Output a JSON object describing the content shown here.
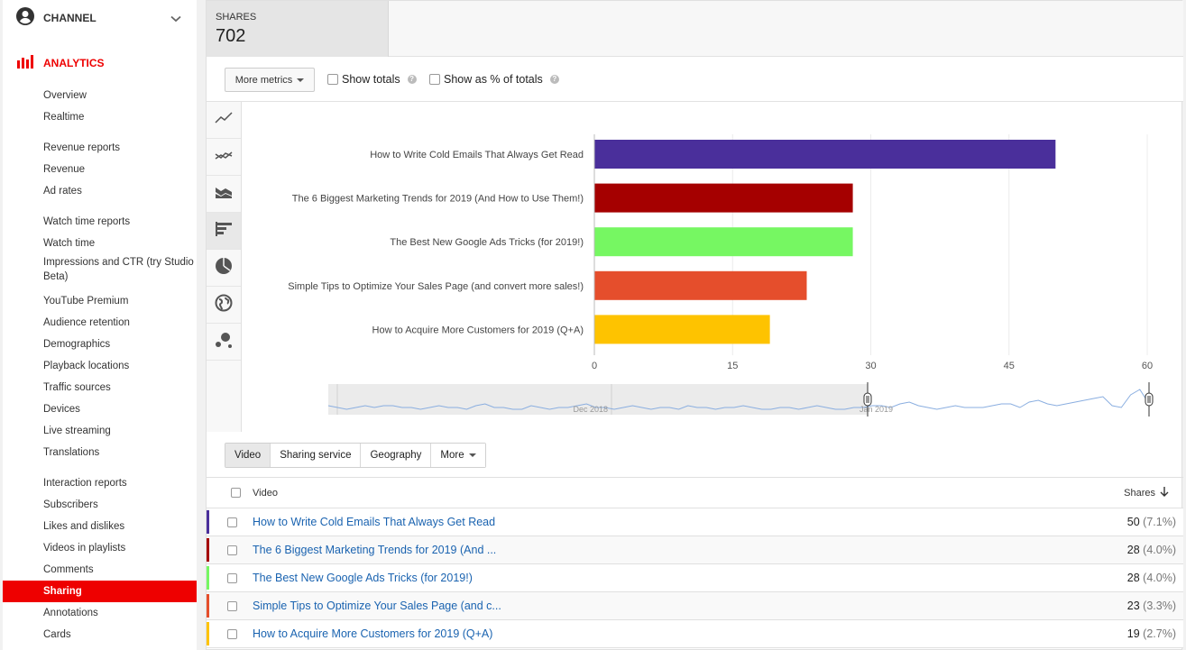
{
  "sidebar": {
    "channel_label": "CHANNEL",
    "analytics_label": "ANALYTICS",
    "items": [
      {
        "label": "Overview",
        "type": "item"
      },
      {
        "label": "Realtime",
        "type": "item"
      },
      {
        "label": "Revenue reports",
        "type": "section"
      },
      {
        "label": "Revenue",
        "type": "item"
      },
      {
        "label": "Ad rates",
        "type": "item"
      },
      {
        "label": "Watch time reports",
        "type": "section"
      },
      {
        "label": "Watch time",
        "type": "item"
      },
      {
        "label": "Impressions and CTR (try Studio Beta)",
        "type": "item"
      },
      {
        "label": "YouTube Premium",
        "type": "item"
      },
      {
        "label": "Audience retention",
        "type": "item"
      },
      {
        "label": "Demographics",
        "type": "item"
      },
      {
        "label": "Playback locations",
        "type": "item"
      },
      {
        "label": "Traffic sources",
        "type": "item"
      },
      {
        "label": "Devices",
        "type": "item"
      },
      {
        "label": "Live streaming",
        "type": "item"
      },
      {
        "label": "Translations",
        "type": "item"
      },
      {
        "label": "Interaction reports",
        "type": "section"
      },
      {
        "label": "Subscribers",
        "type": "item"
      },
      {
        "label": "Likes and dislikes",
        "type": "item"
      },
      {
        "label": "Videos in playlists",
        "type": "item"
      },
      {
        "label": "Comments",
        "type": "item"
      },
      {
        "label": "Sharing",
        "type": "item",
        "active": true
      },
      {
        "label": "Annotations",
        "type": "item"
      },
      {
        "label": "Cards",
        "type": "item"
      }
    ]
  },
  "metric": {
    "label": "SHARES",
    "value": "702"
  },
  "options": {
    "more_metrics_label": "More metrics",
    "show_totals_label": "Show totals",
    "show_pct_label": "Show as % of totals",
    "help_glyph": "?"
  },
  "chart_rail": [
    {
      "icon": "line-chart-icon"
    },
    {
      "icon": "multi-line-chart-icon"
    },
    {
      "icon": "stacked-area-chart-icon"
    },
    {
      "icon": "bar-chart-icon",
      "active": true
    },
    {
      "icon": "pie-chart-icon"
    },
    {
      "icon": "globe-map-icon"
    },
    {
      "icon": "bubble-chart-icon"
    }
  ],
  "chart_data": {
    "type": "bar",
    "orientation": "horizontal",
    "categories": [
      "How to Write Cold Emails That Always Get Read",
      "The 6 Biggest Marketing Trends for 2019 (And How to Use Them!)",
      "The Best New Google Ads Tricks (for 2019!)",
      "Simple Tips to Optimize Your Sales Page (and convert more sales!)",
      "How to Acquire More Customers for 2019 (Q+A)"
    ],
    "values": [
      50,
      28,
      28,
      23,
      19
    ],
    "colors": [
      "#4a2f9b",
      "#a50000",
      "#76f762",
      "#e54e2c",
      "#fec300"
    ],
    "xlim": [
      0,
      60
    ],
    "xticks": [
      "0",
      "15",
      "30",
      "45",
      "60"
    ],
    "grid": true,
    "title": "",
    "xlabel": "",
    "ylabel": "",
    "navigator": {
      "date_labels": [
        "Dec 2018",
        "Jan 2019"
      ],
      "series": [
        3,
        2,
        1,
        2,
        3,
        2,
        3,
        3,
        2,
        2,
        1,
        2,
        3,
        2,
        2,
        1,
        3,
        4,
        2,
        2,
        1,
        1,
        3,
        2,
        1,
        2,
        2,
        3,
        4,
        2,
        2,
        1,
        2,
        3,
        2,
        1,
        2,
        2,
        1,
        3,
        2,
        2,
        1,
        2,
        2,
        3,
        2,
        1,
        1,
        2,
        2,
        1,
        2,
        3,
        2,
        1,
        1,
        2,
        2,
        3,
        3,
        2,
        4,
        5,
        3,
        2,
        1,
        2,
        3,
        2,
        2,
        2,
        3,
        4,
        4,
        2,
        5,
        6,
        4,
        3,
        4,
        5,
        6,
        7,
        8,
        3,
        2,
        9,
        12,
        4
      ]
    }
  },
  "dimension_tabs": [
    {
      "label": "Video",
      "active": true
    },
    {
      "label": "Sharing service"
    },
    {
      "label": "Geography"
    },
    {
      "label": "More",
      "dropdown": true
    }
  ],
  "table": {
    "col_video": "Video",
    "col_shares": "Shares",
    "rows": [
      {
        "title": "How to Write Cold Emails That Always Get Read",
        "value": "50",
        "pct": "(7.1%)",
        "color": "#4a2f9b"
      },
      {
        "title": "The 6 Biggest Marketing Trends for 2019 (And ...",
        "value": "28",
        "pct": "(4.0%)",
        "color": "#a50000"
      },
      {
        "title": "The Best New Google Ads Tricks (for 2019!)",
        "value": "28",
        "pct": "(4.0%)",
        "color": "#76f762"
      },
      {
        "title": "Simple Tips to Optimize Your Sales Page (and c...",
        "value": "23",
        "pct": "(3.3%)",
        "color": "#e54e2c"
      },
      {
        "title": "How to Acquire More Customers for 2019 (Q+A)",
        "value": "19",
        "pct": "(2.7%)",
        "color": "#fec300"
      }
    ]
  }
}
